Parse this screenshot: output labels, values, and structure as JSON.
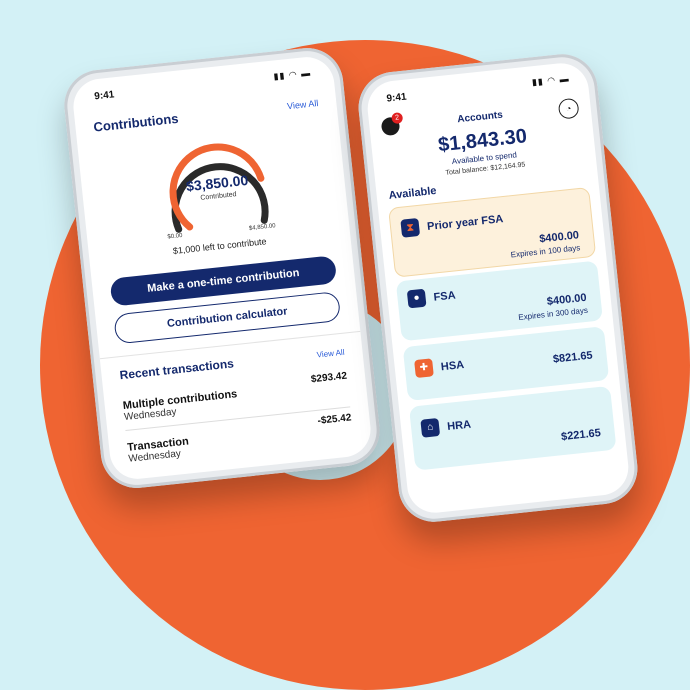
{
  "colors": {
    "accent": "#ef6432",
    "navy": "#14296d",
    "card": "#dff4f7",
    "highlight": "#fdf1dc"
  },
  "left_phone": {
    "time": "9:41",
    "header_title": "Contributions",
    "view_all": "View All",
    "gauge": {
      "amount": "$3,850.00",
      "label": "Contributed",
      "min": "$0.00",
      "max": "$4,850.00",
      "progress": 0.79
    },
    "left_to_contribute": "$1,000 left to contribute",
    "primary_button": "Make a one-time contribution",
    "secondary_button": "Contribution calculator",
    "recent_title": "Recent transactions",
    "recent_view_all": "View All",
    "transactions": [
      {
        "title": "Multiple contributions",
        "sub": "Wednesday",
        "amount": "$293.42"
      },
      {
        "title": "Transaction",
        "sub": "Wednesday",
        "amount": "-$25.42"
      }
    ]
  },
  "right_phone": {
    "time": "9:41",
    "badge": "2",
    "title": "Accounts",
    "balance": "$1,843.30",
    "balance_label": "Available to spend",
    "total_balance": "Total balance: $12,164.95",
    "available_title": "Available",
    "accounts": [
      {
        "name": "Prior year FSA",
        "amount": "$400.00",
        "expires": "Expires in 100 days",
        "icon": "hourglass-icon"
      },
      {
        "name": "FSA",
        "amount": "$400.00",
        "expires": "Expires in 300 days",
        "icon": "piggy-bank-icon"
      },
      {
        "name": "HSA",
        "amount": "$821.65",
        "expires": "",
        "icon": "first-aid-icon"
      },
      {
        "name": "HRA",
        "amount": "$221.65",
        "expires": "",
        "icon": "bank-icon"
      }
    ]
  }
}
